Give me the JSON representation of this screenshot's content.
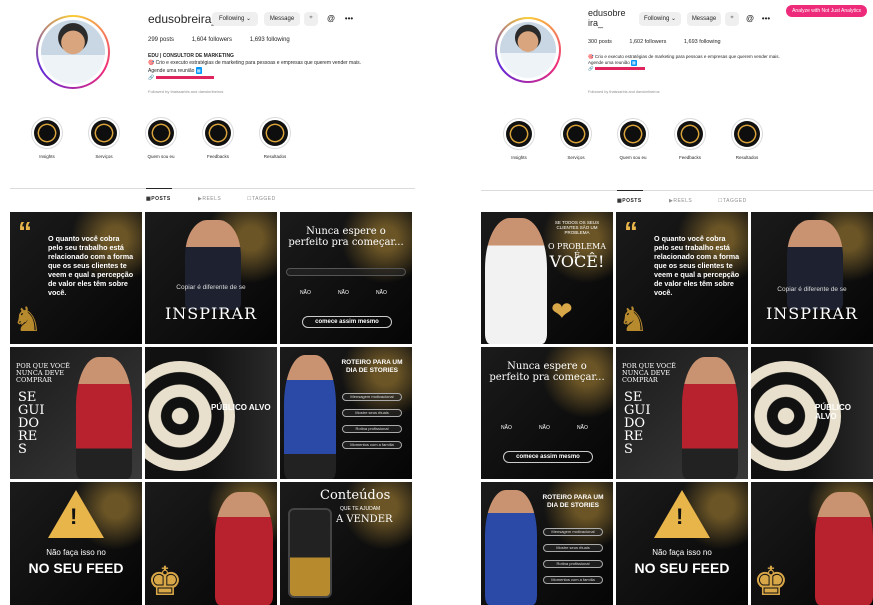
{
  "left": {
    "username": "edusobreira_",
    "following_btn": "Following ⌄",
    "message_btn": "Message",
    "posts": "299 posts",
    "followers": "1,604 followers",
    "following": "1,693 following",
    "bio_title": "EDU | CONSULTOR DE MARKETING",
    "bio_line1": "🎯 Crio e executo estratégias de marketing para pessoas e empresas que querem vender mais.",
    "bio_line2": "Agende uma reunião",
    "followed_by": "Followed by thaissarbis and darwinribeiros",
    "highlights": [
      "Insights",
      "Serviços",
      "Quem sou eu",
      "Feedbacks",
      "Resultados"
    ],
    "tabs": [
      "POSTS",
      "REELS",
      "TAGGED"
    ]
  },
  "right": {
    "username": "edusobre ira_",
    "following_btn": "Following ⌄",
    "message_btn": "Message",
    "posts": "300 posts",
    "followers": "1,602 followers",
    "following": "1,693 following",
    "bio_line1": "🎯 Crio e executo estratégias de marketing para pessoas e empresas que querem vender mais.",
    "bio_line2": "Agende uma reunião",
    "followed_by": "Followed by thaissarbis and darwinribeiros",
    "highlights": [
      "Insights",
      "Serviços",
      "Quem sou eu",
      "Feedbacks",
      "Resultados"
    ],
    "tabs": [
      "POSTS",
      "REELS",
      "TAGGED"
    ],
    "ext_badge": "Analyze with Not Just Analytics"
  },
  "posts": {
    "quote": "O quanto você cobra pelo seu trabalho está relacionado com a forma que os seus clientes te veem e qual a percepção de valor eles têm sobre você.",
    "copiar": "Copiar é diferente de se",
    "inspirar": "INSPIRAR",
    "nunca": "Nunca espere o perfeito pra começar...",
    "nao": "NÃO",
    "comece": "comece assim mesmo",
    "porque": "POR QUE VOCÊ NUNCA DEVE COMPRAR",
    "seguidores": "SE GUI DO RE S",
    "publico": "PÚBLICO ALVO",
    "roteiro": "ROTEIRO PARA UM DIA DE STORIES",
    "stories_items": [
      "Mensagem motivacional",
      "Mostre seus rituais",
      "Rotina profissional",
      "Momentos com a família"
    ],
    "naofaca": "Não faça isso no",
    "noseufeed": "NO SEU FEED",
    "conteudos": "Conteúdos",
    "queteajudam": "QUE TE AJUDAM",
    "avender": "A VENDER",
    "problema1": "SE TODOS OS SEUS CLIENTES SÃO UM PROBLEMA",
    "problema2": "O PROBLEMA É",
    "voce": "VOCÊ!"
  },
  "colors": {
    "accent": "#ee2a7b",
    "gold": "#e8b54b",
    "link": "#0095f6"
  }
}
